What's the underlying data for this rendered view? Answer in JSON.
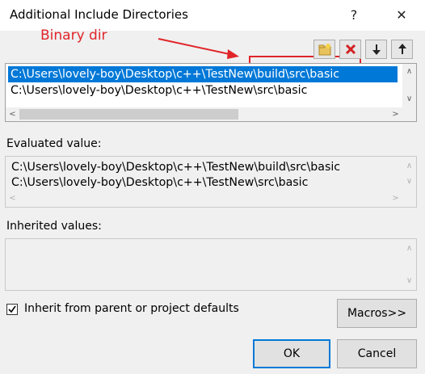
{
  "dialog": {
    "title": "Additional Include Directories",
    "help_glyph": "?",
    "close_glyph": "✕"
  },
  "annotation": {
    "label": "Binary dir",
    "color": "#e0252a"
  },
  "toolbar": {
    "buttons": [
      {
        "name": "new-line",
        "icon": "new-folder-icon"
      },
      {
        "name": "delete",
        "icon": "delete-x-icon"
      },
      {
        "name": "move-down",
        "icon": "arrow-down-icon"
      },
      {
        "name": "move-up",
        "icon": "arrow-up-icon"
      }
    ]
  },
  "directories": {
    "items": [
      "C:\\Users\\lovely-boy\\Desktop\\c++\\TestNew\\build\\src\\basic",
      "C:\\Users\\lovely-boy\\Desktop\\c++\\TestNew\\src\\basic"
    ],
    "selected_index": 0
  },
  "evaluated": {
    "label": "Evaluated value:",
    "lines": [
      "C:\\Users\\lovely-boy\\Desktop\\c++\\TestNew\\build\\src\\basic",
      "C:\\Users\\lovely-boy\\Desktop\\c++\\TestNew\\src\\basic"
    ]
  },
  "inherited": {
    "label": "Inherited values:",
    "lines": []
  },
  "options": {
    "inherit_label": "Inherit from parent or project defaults",
    "inherit_checked": true
  },
  "buttons": {
    "macros": "Macros>>",
    "ok": "OK",
    "cancel": "Cancel"
  },
  "colors": {
    "selection": "#0078d7",
    "default_button_border": "#0078d7"
  }
}
